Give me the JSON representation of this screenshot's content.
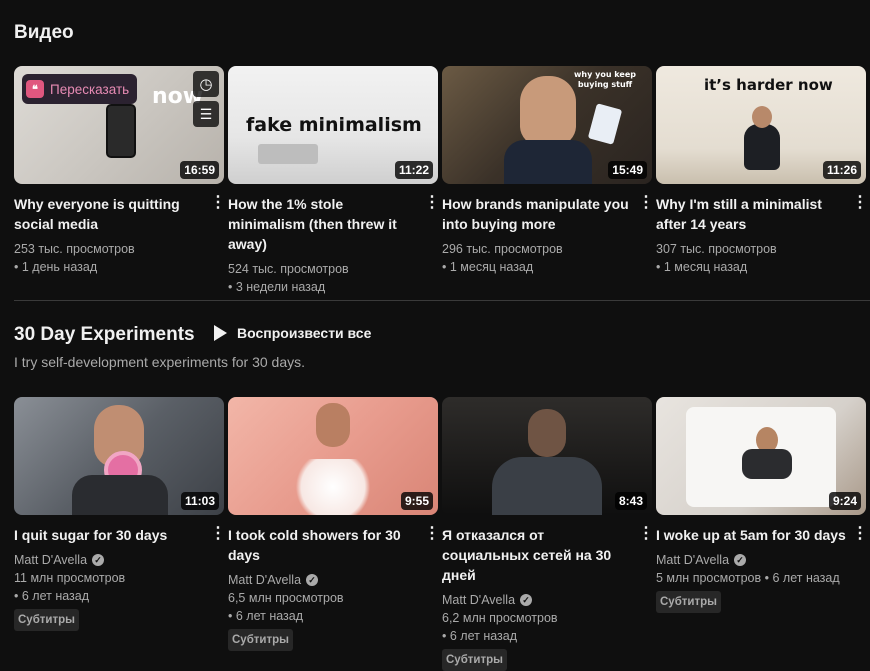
{
  "videos_section": {
    "title": "Видео",
    "retell_label": "Пересказать",
    "items": [
      {
        "title": "Why everyone is quitting social media",
        "views": "253 тыс. просмотров",
        "age": "1 день назад",
        "duration": "16:59",
        "thumb_text": "now"
      },
      {
        "title": "How the 1% stole minimalism (then threw it away)",
        "views": "524 тыс. просмотров",
        "age": "3 недели назад",
        "duration": "11:22",
        "thumb_text": "fake minimalism"
      },
      {
        "title": "How brands manipulate you into buying more",
        "views": "296 тыс. просмотров",
        "age": "1 месяц назад",
        "duration": "15:49",
        "thumb_text": "why you keep buying stuff"
      },
      {
        "title": "Why I'm still a minimalist after 14 years",
        "views": "307 тыс. просмотров",
        "age": "1 месяц назад",
        "duration": "11:26",
        "thumb_text": "it’s harder now"
      }
    ]
  },
  "playlist_section": {
    "title": "30 Day Experiments",
    "play_all": "Воспроизвести все",
    "description": "I try self-development experiments for 30 days.",
    "items": [
      {
        "title": "I quit sugar for 30 days",
        "channel": "Matt D'Avella",
        "views": "11 млн просмотров",
        "age": "6 лет назад",
        "duration": "11:03",
        "badge": "Субтитры"
      },
      {
        "title": "I took cold showers for 30 days",
        "channel": "Matt D'Avella",
        "views": "6,5 млн просмотров",
        "age": "6 лет назад",
        "duration": "9:55",
        "badge": "Субтитры"
      },
      {
        "title": "Я отказался от социальных сетей на 30 дней",
        "channel": "Matt D'Avella",
        "views": "6,2 млн просмотров",
        "age": "6 лет назад",
        "duration": "8:43",
        "badge": "Субтитры"
      },
      {
        "title": "I woke up at 5am for 30 days",
        "channel": "Matt D'Avella",
        "views": "5 млн просмотров",
        "age": "6 лет назад",
        "duration": "9:24",
        "badge": "Субтитры"
      }
    ]
  },
  "icons": {
    "kebab": "more-vert-icon",
    "watch_later": "clock-icon",
    "add_queue": "queue-icon",
    "verified": "check-circle-icon",
    "play": "play-icon"
  }
}
